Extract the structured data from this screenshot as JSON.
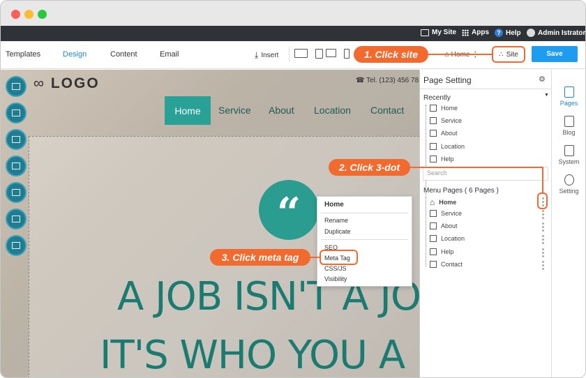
{
  "window": {
    "controls": [
      "close",
      "minimize",
      "maximize"
    ]
  },
  "topnav": {
    "mysite": "My Site",
    "apps": "Apps",
    "help": "Help",
    "user": "Admin Istrator"
  },
  "toolbar": {
    "tabs": [
      "Templates",
      "Design",
      "Content",
      "Email"
    ],
    "active_tab": "Design",
    "insert": "Insert",
    "home_select": "Home",
    "site": "Site",
    "save": "Save"
  },
  "canvas": {
    "logo": "LOGO",
    "tel": "Tel. (123) 456 78",
    "nav": [
      "Home",
      "Service",
      "About",
      "Location",
      "Contact"
    ],
    "quote_mark": "“",
    "headline_1": "A JOB ISN'T A JO",
    "headline_2": "IT'S WHO YOU A"
  },
  "panel": {
    "title": "Page Setting",
    "recently_label": "Recently",
    "recent": [
      "Home",
      "Service",
      "About",
      "Location",
      "Help"
    ],
    "search_placeholder": "Search",
    "menu_label": "Menu Pages ( 6 Pages )",
    "menu": [
      "Home",
      "Service",
      "About",
      "Location",
      "Help",
      "Contact"
    ]
  },
  "rail": {
    "items": [
      "Pages",
      "Blog",
      "System",
      "Setting"
    ]
  },
  "context_menu": {
    "title": "Home",
    "items_1": [
      "Rename",
      "Duplicate"
    ],
    "items_2": [
      "SEO",
      "Meta Tag",
      "CSS/JS",
      "Visibility"
    ]
  },
  "callouts": {
    "step1": "1. Click site",
    "step2": "2. Click 3-dot",
    "step3": "3. Click meta tag"
  },
  "colors": {
    "accent": "#f26a2e",
    "teal": "#2aa197",
    "blue": "#1e9cf0",
    "topbar": "#2f3236"
  }
}
